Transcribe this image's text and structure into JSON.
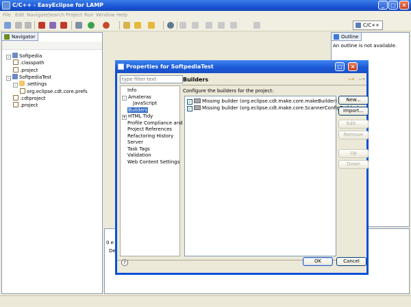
{
  "window": {
    "title": "C/C++ - EasyEclipse for LAMP"
  },
  "menu": [
    "File",
    "Edit",
    "Navigate",
    "Search",
    "Project",
    "Run",
    "Window",
    "Help"
  ],
  "perspective": {
    "label": "C/C++"
  },
  "navigator": {
    "tab_label": "Navigator",
    "items": [
      {
        "label": "Softpedia",
        "indent": 0,
        "type": "proj",
        "expanded": "-"
      },
      {
        "label": ".classpath",
        "indent": 1,
        "type": "file"
      },
      {
        "label": ".project",
        "indent": 1,
        "type": "file"
      },
      {
        "label": "SoftpediaTest",
        "indent": 0,
        "type": "proj",
        "expanded": "-"
      },
      {
        "label": ".settings",
        "indent": 1,
        "type": "folder",
        "expanded": "-"
      },
      {
        "label": "org.eclipse.cdt.core.prefs",
        "indent": 2,
        "type": "file"
      },
      {
        "label": ".cdtproject",
        "indent": 1,
        "type": "file"
      },
      {
        "label": ".project",
        "indent": 1,
        "type": "file"
      }
    ]
  },
  "outline": {
    "tab_label": "Outline",
    "message": "An outline is not available."
  },
  "problems": {
    "count_text": "0 e",
    "column_text": "De"
  },
  "dialog": {
    "title": "Properties for SoftpediaTest",
    "filter_placeholder": "type filter text",
    "tree": [
      {
        "label": "Info",
        "indent": 1
      },
      {
        "label": "Amateras",
        "indent": 0,
        "expander": "-"
      },
      {
        "label": "JavaScript",
        "indent": 2
      },
      {
        "label": "Builders",
        "indent": 1,
        "selected": true
      },
      {
        "label": "HTML Tidy",
        "indent": 0,
        "expander": "+"
      },
      {
        "label": "Profile Compliance and Va",
        "indent": 1
      },
      {
        "label": "Project References",
        "indent": 1
      },
      {
        "label": "Refactoring History",
        "indent": 1
      },
      {
        "label": "Server",
        "indent": 1
      },
      {
        "label": "Task Tags",
        "indent": 1
      },
      {
        "label": "Validation",
        "indent": 1
      },
      {
        "label": "Web Content Settings",
        "indent": 1
      }
    ],
    "page_title": "Builders",
    "description": "Configure the builders for the project:",
    "builders": [
      {
        "label": "Missing builder (org.eclipse.cdt.make.core.makeBuilder)",
        "checked": "✓"
      },
      {
        "label": "Missing builder (org.eclipse.cdt.make.core.ScannerConfigBuilder)",
        "checked": "✓"
      }
    ],
    "buttons": {
      "new": "New...",
      "import": "Import...",
      "edit": "Edit...",
      "remove": "Remove",
      "up": "Up",
      "down": "Down",
      "ok": "OK",
      "cancel": "Cancel"
    },
    "help_glyph": "?"
  }
}
